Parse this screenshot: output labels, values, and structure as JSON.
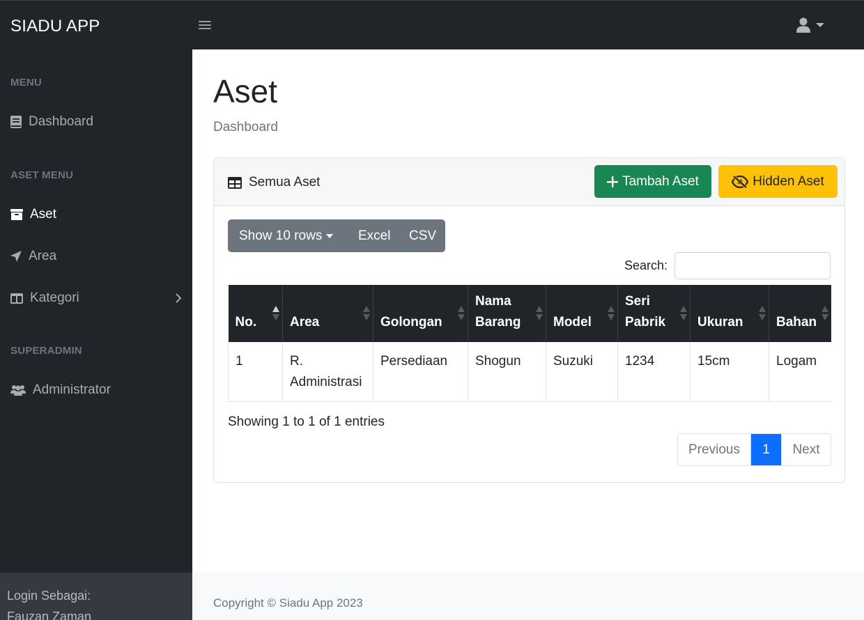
{
  "navbar": {
    "brand": "SIADU APP",
    "toggle_icon": "bars-icon",
    "user_icon": "user-icon"
  },
  "sidebar": {
    "headings": [
      "MENU",
      "ASET MENU",
      "SUPERADMIN"
    ],
    "items": [
      {
        "label": "Dashboard",
        "icon": "book-icon",
        "active": false
      },
      {
        "label": "Aset",
        "icon": "archive-icon",
        "active": true
      },
      {
        "label": "Area",
        "icon": "location-arrow-icon",
        "active": false
      },
      {
        "label": "Kategori",
        "icon": "columns-icon",
        "active": false,
        "has_submenu": true
      },
      {
        "label": "Administrator",
        "icon": "users-icon",
        "active": false
      }
    ],
    "footer": {
      "label": "Login Sebagai:",
      "user": "Fauzan Zaman"
    }
  },
  "page": {
    "title": "Aset",
    "breadcrumb": "Dashboard"
  },
  "card": {
    "title": "Semua Aset",
    "title_icon": "table-icon",
    "add_button": "Tambah Aset",
    "hidden_button": "Hidden Aset"
  },
  "toolbar": {
    "show_rows": "Show 10 rows",
    "excel": "Excel",
    "csv": "CSV"
  },
  "search": {
    "label": "Search:",
    "value": ""
  },
  "table": {
    "headers": [
      "No.",
      "Area",
      "Golongan",
      "Nama Barang",
      "Model",
      "Seri Pabrik",
      "Ukuran",
      "Bahan"
    ],
    "rows": [
      [
        "1",
        "R. Administrasi",
        "Persediaan",
        "Shogun",
        "Suzuki",
        "1234",
        "15cm",
        "Logam"
      ]
    ]
  },
  "info": "Showing 1 to 1 of 1 entries",
  "pagination": {
    "previous": "Previous",
    "current": "1",
    "next": "Next"
  },
  "footer": {
    "text": "Copyright © Siadu App 2023"
  },
  "colors": {
    "dark": "#212529",
    "success": "#198754",
    "warning": "#ffc107",
    "primary": "#0d6efd",
    "secondary": "#6c757d"
  }
}
